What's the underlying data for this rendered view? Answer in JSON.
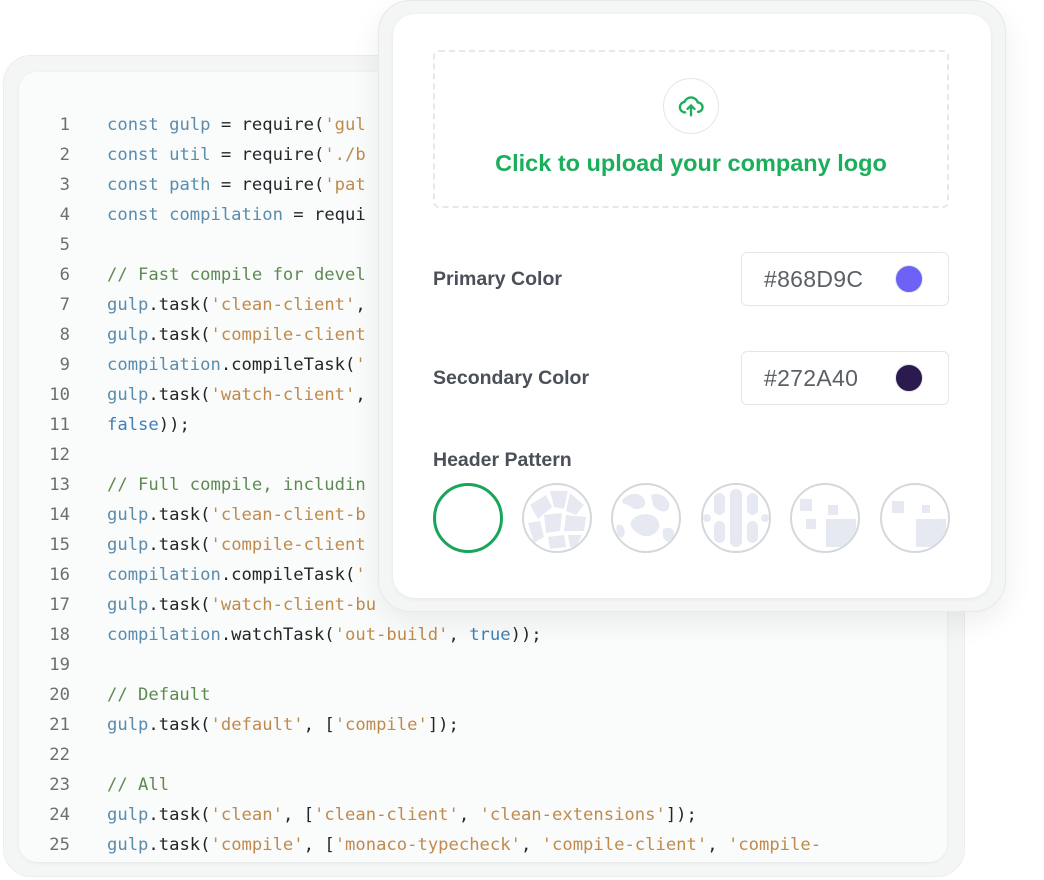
{
  "code": {
    "lines": [
      {
        "n": "1",
        "t": [
          [
            "kw",
            "const "
          ],
          [
            "var",
            "gulp"
          ],
          [
            "pl",
            " = require("
          ],
          [
            "str",
            "'gul"
          ]
        ]
      },
      {
        "n": "2",
        "t": [
          [
            "kw",
            "const "
          ],
          [
            "var",
            "util"
          ],
          [
            "pl",
            " = require("
          ],
          [
            "str",
            "'./b"
          ]
        ]
      },
      {
        "n": "3",
        "t": [
          [
            "kw",
            "const "
          ],
          [
            "var",
            "path"
          ],
          [
            "pl",
            " = require("
          ],
          [
            "str",
            "'pat"
          ]
        ]
      },
      {
        "n": "4",
        "t": [
          [
            "kw",
            "const "
          ],
          [
            "var",
            "compilation"
          ],
          [
            "pl",
            " = requi"
          ]
        ]
      },
      {
        "n": "5",
        "t": []
      },
      {
        "n": "6",
        "t": [
          [
            "cm",
            "// Fast compile for devel"
          ]
        ]
      },
      {
        "n": "7",
        "t": [
          [
            "var",
            "gulp"
          ],
          [
            "pl",
            ".task("
          ],
          [
            "str",
            "'clean-client'"
          ],
          [
            "pl",
            ","
          ]
        ]
      },
      {
        "n": "8",
        "t": [
          [
            "var",
            "gulp"
          ],
          [
            "pl",
            ".task("
          ],
          [
            "str",
            "'compile-client"
          ]
        ]
      },
      {
        "n": "9",
        "t": [
          [
            "var",
            "compilation"
          ],
          [
            "pl",
            ".compileTask("
          ],
          [
            "str",
            "'"
          ]
        ]
      },
      {
        "n": "10",
        "t": [
          [
            "var",
            "gulp"
          ],
          [
            "pl",
            ".task("
          ],
          [
            "str",
            "'watch-client'"
          ],
          [
            "pl",
            ","
          ]
        ]
      },
      {
        "n": "11",
        "t": [
          [
            "bool",
            "false"
          ],
          [
            "pl",
            "));"
          ]
        ]
      },
      {
        "n": "12",
        "t": []
      },
      {
        "n": "13",
        "t": [
          [
            "cm",
            "// Full compile, includin"
          ]
        ]
      },
      {
        "n": "14",
        "t": [
          [
            "var",
            "gulp"
          ],
          [
            "pl",
            ".task("
          ],
          [
            "str",
            "'clean-client-b"
          ]
        ]
      },
      {
        "n": "15",
        "t": [
          [
            "var",
            "gulp"
          ],
          [
            "pl",
            ".task("
          ],
          [
            "str",
            "'compile-client"
          ]
        ]
      },
      {
        "n": "16",
        "t": [
          [
            "var",
            "compilation"
          ],
          [
            "pl",
            ".compileTask("
          ],
          [
            "str",
            "'"
          ]
        ]
      },
      {
        "n": "17",
        "t": [
          [
            "var",
            "gulp"
          ],
          [
            "pl",
            ".task("
          ],
          [
            "str",
            "'watch-client-bu"
          ]
        ]
      },
      {
        "n": "18",
        "t": [
          [
            "var",
            "compilation"
          ],
          [
            "pl",
            ".watchTask("
          ],
          [
            "str",
            "'out-build'"
          ],
          [
            "pl",
            ", "
          ],
          [
            "bool",
            "true"
          ],
          [
            "pl",
            "));"
          ]
        ]
      },
      {
        "n": "19",
        "t": []
      },
      {
        "n": "20",
        "t": [
          [
            "cm",
            "// Default"
          ]
        ]
      },
      {
        "n": "21",
        "t": [
          [
            "var",
            "gulp"
          ],
          [
            "pl",
            ".task("
          ],
          [
            "str",
            "'default'"
          ],
          [
            "pl",
            ", ["
          ],
          [
            "str",
            "'compile'"
          ],
          [
            "pl",
            "]);"
          ]
        ]
      },
      {
        "n": "22",
        "t": []
      },
      {
        "n": "23",
        "t": [
          [
            "cm",
            "// All"
          ]
        ]
      },
      {
        "n": "24",
        "t": [
          [
            "var",
            "gulp"
          ],
          [
            "pl",
            ".task("
          ],
          [
            "str",
            "'clean'"
          ],
          [
            "pl",
            ", ["
          ],
          [
            "str",
            "'clean-client'"
          ],
          [
            "pl",
            ", "
          ],
          [
            "str",
            "'clean-extensions'"
          ],
          [
            "pl",
            "]);"
          ]
        ]
      },
      {
        "n": "25",
        "t": [
          [
            "var",
            "gulp"
          ],
          [
            "pl",
            ".task("
          ],
          [
            "str",
            "'compile'"
          ],
          [
            "pl",
            ", ["
          ],
          [
            "str",
            "'monaco-typecheck'"
          ],
          [
            "pl",
            ", "
          ],
          [
            "str",
            "'compile-client'"
          ],
          [
            "pl",
            ", "
          ],
          [
            "str",
            "'compile-"
          ]
        ]
      }
    ]
  },
  "settings": {
    "upload": {
      "label": "Click to upload your company logo",
      "icon": "cloud-upload-icon"
    },
    "primary_color": {
      "label": "Primary Color",
      "value": "#868D9C",
      "swatch": "#6d62f5"
    },
    "secondary_color": {
      "label": "Secondary Color",
      "value": "#272A40",
      "swatch": "#2a1a4e"
    },
    "header_pattern": {
      "label": "Header Pattern",
      "selected_index": 0,
      "options": [
        "pattern-none",
        "pattern-blocks",
        "pattern-blobs",
        "pattern-dots-lines",
        "pattern-squares",
        "pattern-squares-alt"
      ]
    }
  },
  "colors": {
    "accent": "#1bae5b",
    "selected_border": "#1aa55a",
    "pattern_fill": "#e7e9f2"
  }
}
